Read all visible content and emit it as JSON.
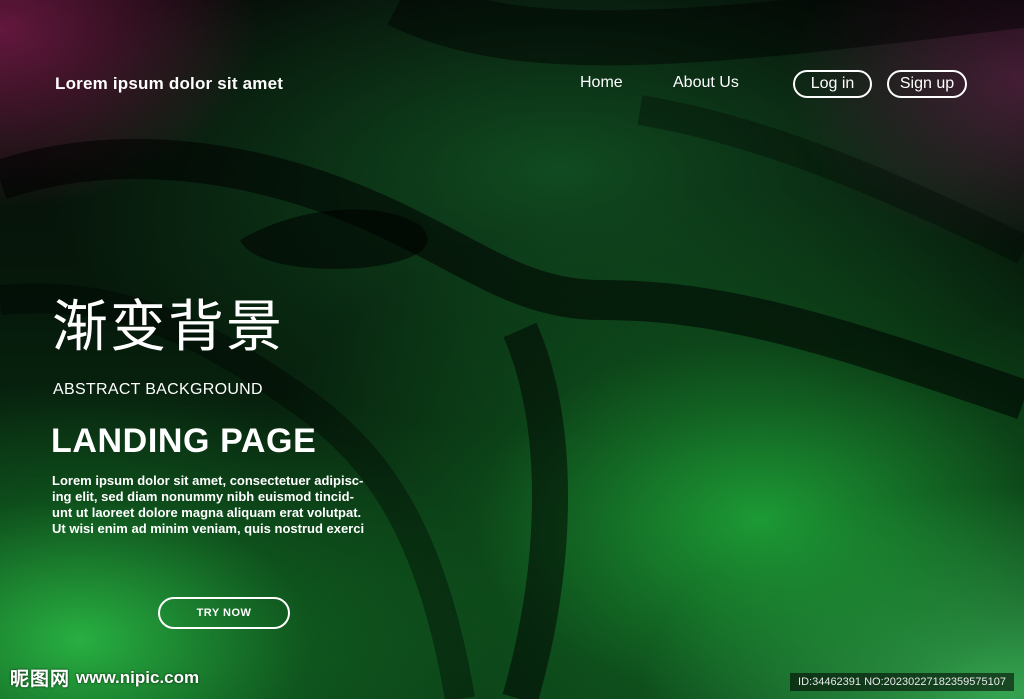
{
  "nav": {
    "brand": "Lorem ipsum dolor sit amet",
    "links": [
      {
        "label": "Home"
      },
      {
        "label": "About Us"
      }
    ],
    "login_label": "Log in",
    "signup_label": "Sign up"
  },
  "hero": {
    "cn_title": "渐变背景",
    "subtitle": "ABSTRACT BACKGROUND",
    "title": "LANDING PAGE",
    "body_lines": [
      "Lorem ipsum dolor sit amet, consectetuer adipisc-",
      "ing elit, sed diam nonummy nibh euismod tincid-",
      "unt ut laoreet dolore magna aliquam erat volutpat.",
      "Ut wisi enim ad minim veniam, quis nostrud exerci"
    ],
    "cta_label": "TRY NOW"
  },
  "watermark": {
    "site_name": "昵图网",
    "site_url": "www.nipic.com",
    "id_text": "ID:34462391 NO:20230227182359575107"
  },
  "colors": {
    "text": "#ffffff",
    "accent_green": "#2ea84a",
    "magenta_glow": "#961e5a",
    "background_dark": "#020604"
  }
}
